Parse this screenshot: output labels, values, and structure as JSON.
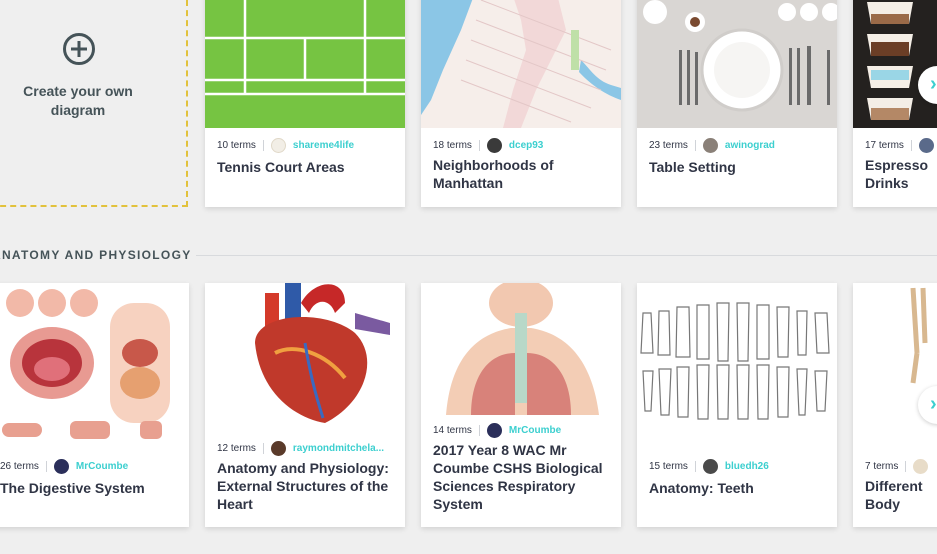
{
  "create": {
    "label": "Create your own diagram"
  },
  "section": {
    "title": "ANATOMY AND PHYSIOLOGY"
  },
  "row1": [
    {
      "terms": "10 terms",
      "user": "shareme4life",
      "title": "Tennis Court Areas"
    },
    {
      "terms": "18 terms",
      "user": "dcep93",
      "title": "Neighborhoods of Manhattan"
    },
    {
      "terms": "23 terms",
      "user": "awinograd",
      "title": "Table Setting"
    },
    {
      "terms": "17 terms",
      "user": "",
      "title": "Espresso Drinks"
    }
  ],
  "row2": [
    {
      "terms": "26 terms",
      "user": "MrCoumbe",
      "title": "The Digestive System"
    },
    {
      "terms": "12 terms",
      "user": "raymondmitchela...",
      "title": "Anatomy and Physiology: External Structures of the Heart"
    },
    {
      "terms": "14 terms",
      "user": "MrCoumbe",
      "title": "2017 Year 8 WAC Mr Coumbe CSHS Biological Sciences Respiratory System"
    },
    {
      "terms": "15 terms",
      "user": "bluedh26",
      "title": "Anatomy: Teeth"
    },
    {
      "terms": "7 terms",
      "user": "",
      "title": "Different Body"
    }
  ],
  "arrows": {
    "next_icon": "chevron-right-icon"
  }
}
